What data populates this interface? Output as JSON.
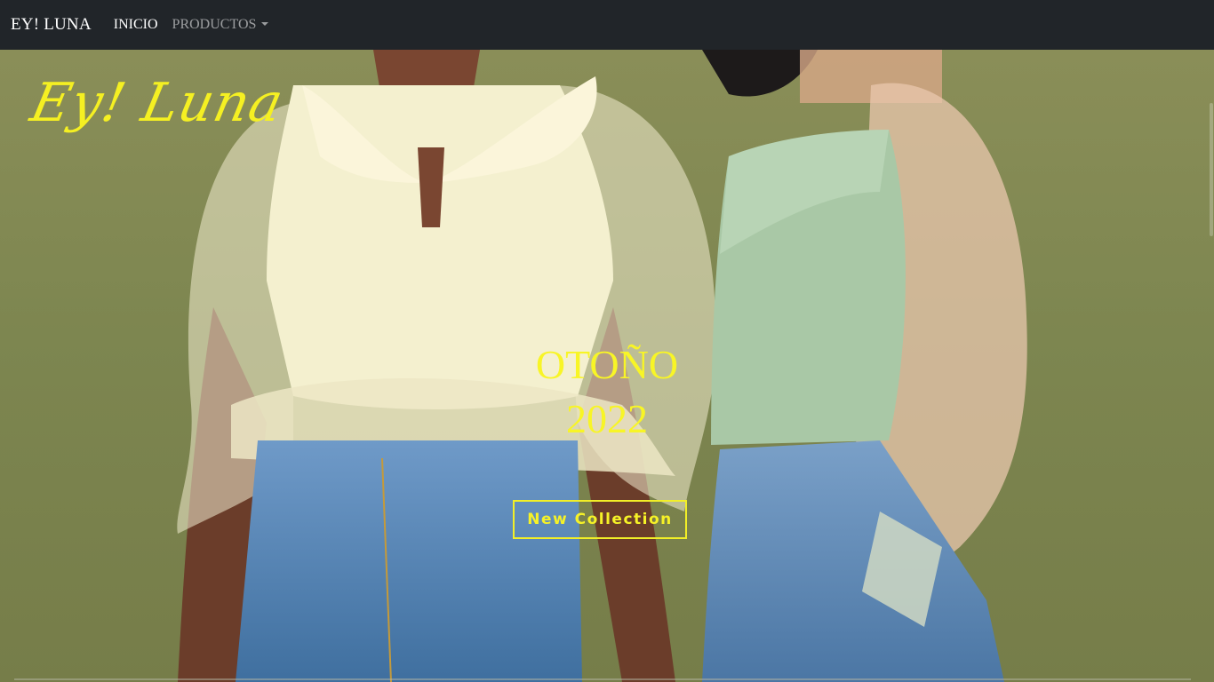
{
  "navbar": {
    "brand": "EY! LUNA",
    "links": [
      {
        "label": "INICIO",
        "active": true
      },
      {
        "label": "PRODUCTOS",
        "dropdown": true
      }
    ]
  },
  "hero": {
    "logo_text": "Ey! Luna",
    "title_line1": "OTOÑO",
    "title_line2": "2022",
    "cta_label": "New Collection",
    "accent_color": "#f6f227"
  }
}
